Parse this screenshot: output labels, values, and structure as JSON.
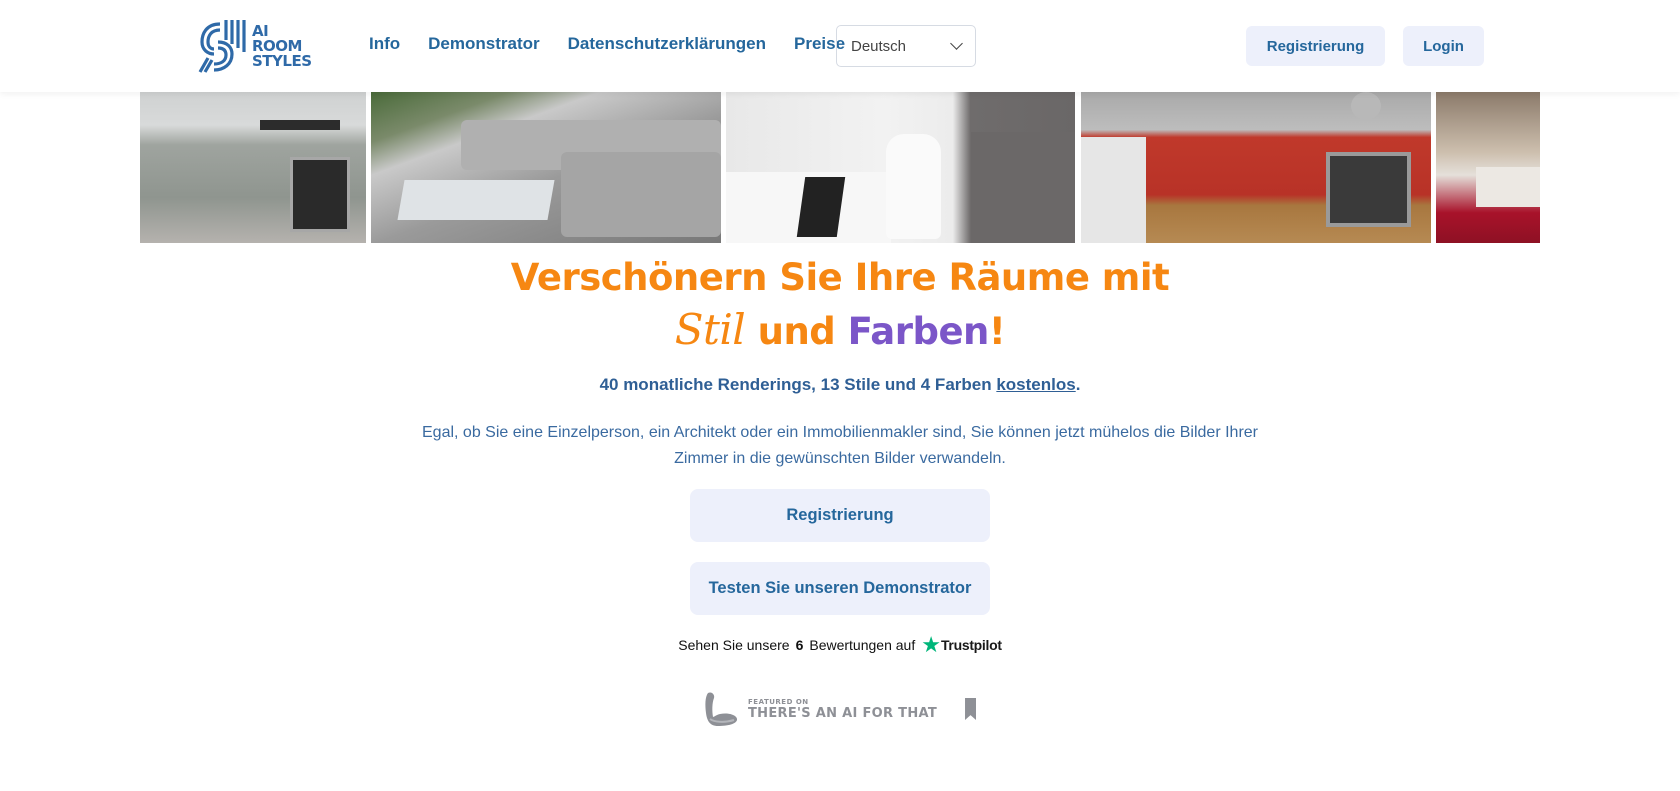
{
  "header": {
    "logo": {
      "lines": [
        "AI",
        "ROOM",
        "STYLES"
      ],
      "icon": "ai-room-styles-logo-icon"
    },
    "nav": [
      {
        "label": "Info"
      },
      {
        "label": "Demonstrator"
      },
      {
        "label": "Datenschutzerklärungen"
      },
      {
        "label": "Preise"
      }
    ],
    "language_select": {
      "value": "Deutsch",
      "icon": "chevron-down-icon"
    },
    "register_label": "Registrierung",
    "login_label": "Login"
  },
  "gallery": {
    "images": [
      {
        "name": "gray-kitchen"
      },
      {
        "name": "gray-living-room"
      },
      {
        "name": "white-bathroom"
      },
      {
        "name": "red-kitchen"
      },
      {
        "name": "red-living-room"
      }
    ]
  },
  "hero": {
    "title_line1": "Verschönern Sie Ihre Räume mit",
    "title_stil": "Stil",
    "title_und": " und ",
    "title_farben": "Farben",
    "title_end": "!",
    "subtitle_prefix": "40 monatliche Renderings, 13 Stile und 4 Farben ",
    "subtitle_link": "kostenlos",
    "subtitle_suffix": ".",
    "description": "Egal, ob Sie eine Einzelperson, ein Architekt oder ein Immobilienmakler sind, Sie können jetzt mühelos die Bilder Ihrer Zimmer in die gewünschten Bilder verwandeln.",
    "register_button": "Registrierung",
    "demo_button": "Testen Sie unseren Demonstrator"
  },
  "trustpilot": {
    "prefix": "Sehen Sie unsere",
    "count": "6",
    "suffix": "Bewertungen auf",
    "brand": "Trustpilot",
    "star_color": "#00b67a"
  },
  "badge": {
    "small": "FEATURED ON",
    "big": "THERE'S AN AI FOR THAT"
  },
  "colors": {
    "brand_blue": "#25679c",
    "orange": "#f68712",
    "purple": "#7b56c8",
    "button_bg": "#edf0fb"
  }
}
